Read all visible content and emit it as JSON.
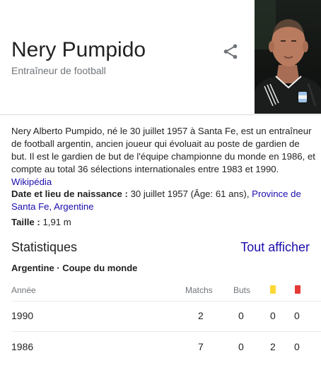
{
  "header": {
    "title": "Nery Pumpido",
    "subtitle": "Entraîneur de football",
    "share_icon": "share-icon",
    "photo_icon": "person-photo"
  },
  "description": {
    "text": "Nery Alberto Pumpido, né le 30 juillet 1957 à Santa Fe, est un entraîneur de football argentin, ancien joueur qui évoluait au poste de gardien de but. Il est le gardien de but de l'équipe championne du monde en 1986, et compte au total 36 sélections internationales entre 1983 et 1990.",
    "source_link": "Wikipédia"
  },
  "facts": {
    "birth": {
      "label": "Date et lieu de naissance :",
      "value": "30 juillet 1957 (Âge: 61 ans),",
      "link": "Province de Santa Fe, Argentine"
    },
    "height": {
      "label": "Taille :",
      "value": "1,91 m"
    }
  },
  "stats": {
    "title": "Statistiques",
    "see_all": "Tout afficher",
    "team": "Argentine · Coupe du monde",
    "columns": {
      "year": "Année",
      "matches": "Matchs",
      "goals": "Buts",
      "yellow_icon": "yellow-card-icon",
      "red_icon": "red-card-icon"
    },
    "colors": {
      "yellow": "#fdd835",
      "red": "#e53935"
    },
    "rows": [
      {
        "year": "1990",
        "matches": "2",
        "goals": "0",
        "yellow": "0",
        "red": "0"
      },
      {
        "year": "1986",
        "matches": "7",
        "goals": "0",
        "yellow": "2",
        "red": "0"
      }
    ]
  }
}
